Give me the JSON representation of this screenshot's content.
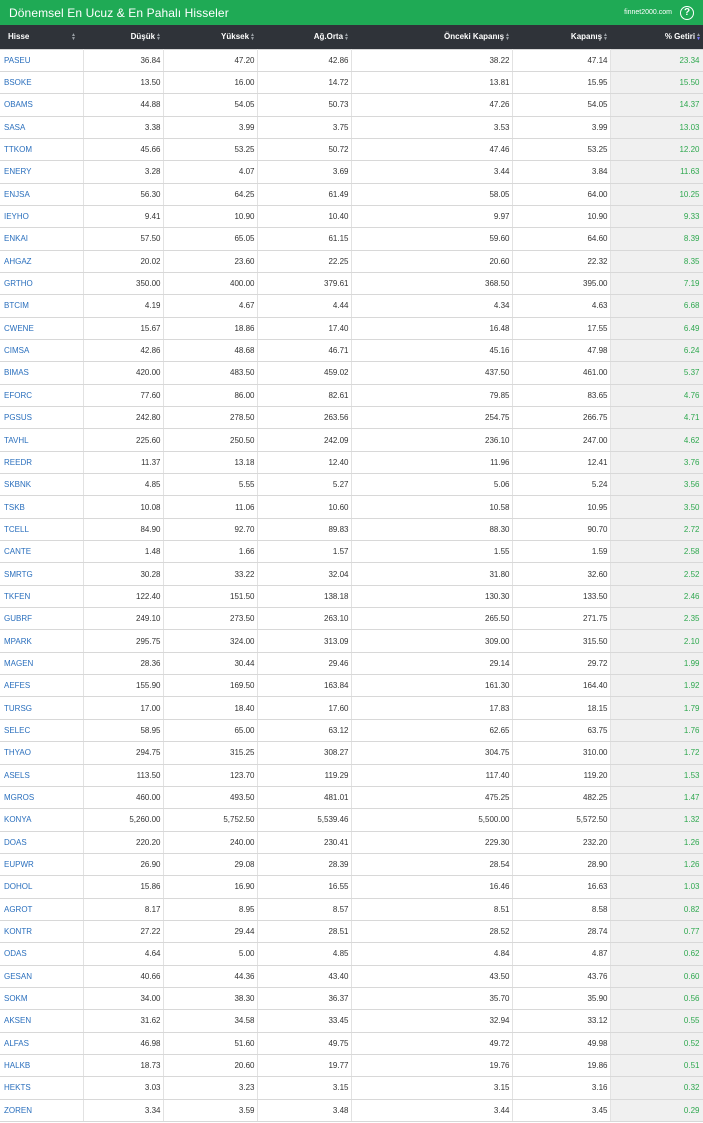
{
  "header": {
    "title": "Dönemsel En Ucuz & En Pahalı Hisseler",
    "brand": "finnet2000.com",
    "help_label": "?"
  },
  "columns": [
    "Hisse",
    "Düşük",
    "Yüksek",
    "Ağ.Orta",
    "Önceki Kapanış",
    "Kapanış",
    "% Getiri"
  ],
  "rows": [
    [
      "PASEU",
      "36.84",
      "47.20",
      "42.86",
      "38.22",
      "47.14",
      "23.34"
    ],
    [
      "BSOKE",
      "13.50",
      "16.00",
      "14.72",
      "13.81",
      "15.95",
      "15.50"
    ],
    [
      "OBAMS",
      "44.88",
      "54.05",
      "50.73",
      "47.26",
      "54.05",
      "14.37"
    ],
    [
      "SASA",
      "3.38",
      "3.99",
      "3.75",
      "3.53",
      "3.99",
      "13.03"
    ],
    [
      "TTKOM",
      "45.66",
      "53.25",
      "50.72",
      "47.46",
      "53.25",
      "12.20"
    ],
    [
      "ENERY",
      "3.28",
      "4.07",
      "3.69",
      "3.44",
      "3.84",
      "11.63"
    ],
    [
      "ENJSA",
      "56.30",
      "64.25",
      "61.49",
      "58.05",
      "64.00",
      "10.25"
    ],
    [
      "IEYHO",
      "9.41",
      "10.90",
      "10.40",
      "9.97",
      "10.90",
      "9.33"
    ],
    [
      "ENKAI",
      "57.50",
      "65.05",
      "61.15",
      "59.60",
      "64.60",
      "8.39"
    ],
    [
      "AHGAZ",
      "20.02",
      "23.60",
      "22.25",
      "20.60",
      "22.32",
      "8.35"
    ],
    [
      "GRTHO",
      "350.00",
      "400.00",
      "379.61",
      "368.50",
      "395.00",
      "7.19"
    ],
    [
      "BTCIM",
      "4.19",
      "4.67",
      "4.44",
      "4.34",
      "4.63",
      "6.68"
    ],
    [
      "CWENE",
      "15.67",
      "18.86",
      "17.40",
      "16.48",
      "17.55",
      "6.49"
    ],
    [
      "CIMSA",
      "42.86",
      "48.68",
      "46.71",
      "45.16",
      "47.98",
      "6.24"
    ],
    [
      "BIMAS",
      "420.00",
      "483.50",
      "459.02",
      "437.50",
      "461.00",
      "5.37"
    ],
    [
      "EFORC",
      "77.60",
      "86.00",
      "82.61",
      "79.85",
      "83.65",
      "4.76"
    ],
    [
      "PGSUS",
      "242.80",
      "278.50",
      "263.56",
      "254.75",
      "266.75",
      "4.71"
    ],
    [
      "TAVHL",
      "225.60",
      "250.50",
      "242.09",
      "236.10",
      "247.00",
      "4.62"
    ],
    [
      "REEDR",
      "11.37",
      "13.18",
      "12.40",
      "11.96",
      "12.41",
      "3.76"
    ],
    [
      "SKBNK",
      "4.85",
      "5.55",
      "5.27",
      "5.06",
      "5.24",
      "3.56"
    ],
    [
      "TSKB",
      "10.08",
      "11.06",
      "10.60",
      "10.58",
      "10.95",
      "3.50"
    ],
    [
      "TCELL",
      "84.90",
      "92.70",
      "89.83",
      "88.30",
      "90.70",
      "2.72"
    ],
    [
      "CANTE",
      "1.48",
      "1.66",
      "1.57",
      "1.55",
      "1.59",
      "2.58"
    ],
    [
      "SMRTG",
      "30.28",
      "33.22",
      "32.04",
      "31.80",
      "32.60",
      "2.52"
    ],
    [
      "TKFEN",
      "122.40",
      "151.50",
      "138.18",
      "130.30",
      "133.50",
      "2.46"
    ],
    [
      "GUBRF",
      "249.10",
      "273.50",
      "263.10",
      "265.50",
      "271.75",
      "2.35"
    ],
    [
      "MPARK",
      "295.75",
      "324.00",
      "313.09",
      "309.00",
      "315.50",
      "2.10"
    ],
    [
      "MAGEN",
      "28.36",
      "30.44",
      "29.46",
      "29.14",
      "29.72",
      "1.99"
    ],
    [
      "AEFES",
      "155.90",
      "169.50",
      "163.84",
      "161.30",
      "164.40",
      "1.92"
    ],
    [
      "TURSG",
      "17.00",
      "18.40",
      "17.60",
      "17.83",
      "18.15",
      "1.79"
    ],
    [
      "SELEC",
      "58.95",
      "65.00",
      "63.12",
      "62.65",
      "63.75",
      "1.76"
    ],
    [
      "THYAO",
      "294.75",
      "315.25",
      "308.27",
      "304.75",
      "310.00",
      "1.72"
    ],
    [
      "ASELS",
      "113.50",
      "123.70",
      "119.29",
      "117.40",
      "119.20",
      "1.53"
    ],
    [
      "MGROS",
      "460.00",
      "493.50",
      "481.01",
      "475.25",
      "482.25",
      "1.47"
    ],
    [
      "KONYA",
      "5,260.00",
      "5,752.50",
      "5,539.46",
      "5,500.00",
      "5,572.50",
      "1.32"
    ],
    [
      "DOAS",
      "220.20",
      "240.00",
      "230.41",
      "229.30",
      "232.20",
      "1.26"
    ],
    [
      "EUPWR",
      "26.90",
      "29.08",
      "28.39",
      "28.54",
      "28.90",
      "1.26"
    ],
    [
      "DOHOL",
      "15.86",
      "16.90",
      "16.55",
      "16.46",
      "16.63",
      "1.03"
    ],
    [
      "AGROT",
      "8.17",
      "8.95",
      "8.57",
      "8.51",
      "8.58",
      "0.82"
    ],
    [
      "KONTR",
      "27.22",
      "29.44",
      "28.51",
      "28.52",
      "28.74",
      "0.77"
    ],
    [
      "ODAS",
      "4.64",
      "5.00",
      "4.85",
      "4.84",
      "4.87",
      "0.62"
    ],
    [
      "GESAN",
      "40.66",
      "44.36",
      "43.40",
      "43.50",
      "43.76",
      "0.60"
    ],
    [
      "SOKM",
      "34.00",
      "38.30",
      "36.37",
      "35.70",
      "35.90",
      "0.56"
    ],
    [
      "AKSEN",
      "31.62",
      "34.58",
      "33.45",
      "32.94",
      "33.12",
      "0.55"
    ],
    [
      "ALFAS",
      "46.98",
      "51.60",
      "49.75",
      "49.72",
      "49.98",
      "0.52"
    ],
    [
      "HALKB",
      "18.73",
      "20.60",
      "19.77",
      "19.76",
      "19.86",
      "0.51"
    ],
    [
      "HEKTS",
      "3.03",
      "3.23",
      "3.15",
      "3.15",
      "3.16",
      "0.32"
    ],
    [
      "ZOREN",
      "3.34",
      "3.59",
      "3.48",
      "3.44",
      "3.45",
      "0.29"
    ]
  ],
  "colors": {
    "header_green": "#1faa55",
    "table_head": "#2f3339",
    "link_blue": "#2a6fbd",
    "gain_green": "#2fa84f"
  },
  "sort": {
    "column": "% Getiri",
    "direction": "desc"
  }
}
